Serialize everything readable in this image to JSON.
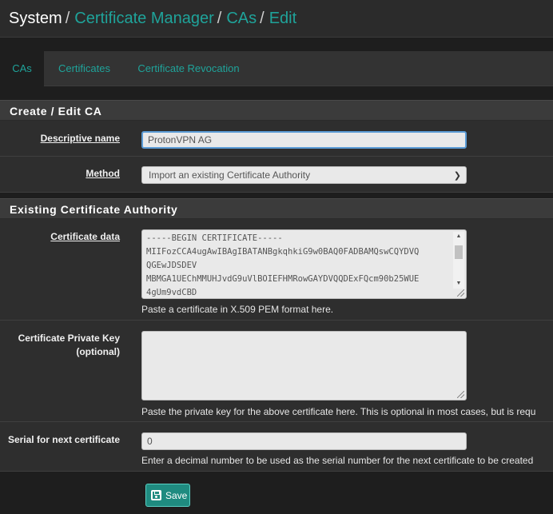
{
  "breadcrumb": {
    "root": "System",
    "items": [
      "Certificate Manager",
      "CAs",
      "Edit"
    ],
    "separator": "/"
  },
  "tabs": [
    {
      "label": "CAs",
      "active": true
    },
    {
      "label": "Certificates",
      "active": false
    },
    {
      "label": "Certificate Revocation",
      "active": false
    }
  ],
  "sections": {
    "create_edit": "Create / Edit CA",
    "existing": "Existing Certificate Authority"
  },
  "fields": {
    "descriptive_name": {
      "label": "Descriptive name",
      "value": "ProtonVPN AG"
    },
    "method": {
      "label": "Method",
      "value": "Import an existing Certificate Authority"
    },
    "certificate_data": {
      "label": "Certificate data",
      "lines": [
        "-----BEGIN CERTIFICATE-----",
        "MIIFozCCA4ugAwIBAgIBATANBgkqhkiG9w0BAQ0FADBAMQswCQYDVQ",
        "QGEwJDSDEV",
        "MBMGA1UEChMMUHJvdG9uVlBOIEFHMRowGAYDVQQDExFQcm90b25WUE",
        "4gUm9vdCBD"
      ],
      "help": "Paste a certificate in X.509 PEM format here."
    },
    "private_key": {
      "label_line1": "Certificate Private Key",
      "label_line2": "(optional)",
      "value": "",
      "help": "Paste the private key for the above certificate here. This is optional in most cases, but is requ"
    },
    "serial": {
      "label": "Serial for next certificate",
      "value": "0",
      "help": "Enter a decimal number to be used as the serial number for the next certificate to be created"
    }
  },
  "save": {
    "label": "Save"
  },
  "colors": {
    "accent": "#1fa39a",
    "save_button": "#1f8b80"
  }
}
